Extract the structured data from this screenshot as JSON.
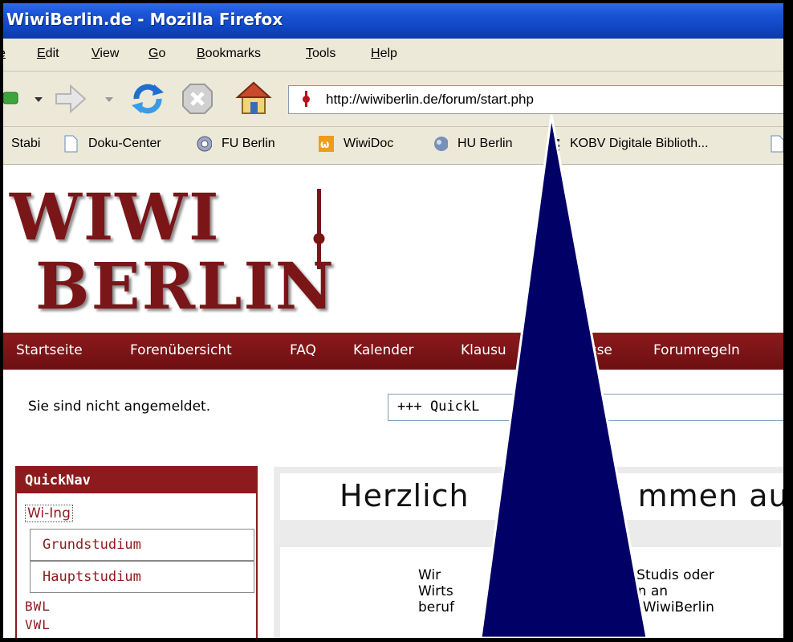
{
  "window": {
    "title": "WiwiBerlin.de - Mozilla Firefox"
  },
  "menu": [
    {
      "label": "e"
    },
    {
      "label": "Edit"
    },
    {
      "label": "View"
    },
    {
      "label": "Go"
    },
    {
      "label": "Bookmarks"
    },
    {
      "label": "Tools"
    },
    {
      "label": "Help"
    }
  ],
  "address": {
    "url": "http://wiwiberlin.de/forum/start.php"
  },
  "bookmarks": [
    {
      "label": "Stabi"
    },
    {
      "label": "Doku-Center"
    },
    {
      "label": "FU Berlin"
    },
    {
      "label": "WiwiDoc"
    },
    {
      "label": "HU Berlin"
    },
    {
      "label": "KOBV Digitale Biblioth..."
    }
  ],
  "logo": {
    "line1": "WIWI",
    "line2": "BERLIN"
  },
  "site_nav": [
    {
      "label": "Startseite"
    },
    {
      "label": "Forenübersicht"
    },
    {
      "label": "FAQ"
    },
    {
      "label": "Kalender"
    },
    {
      "label": "Klausu"
    },
    {
      "label": "isse"
    },
    {
      "label": "Forumregeln"
    }
  ],
  "login_status": "Sie sind nicht angemeldet.",
  "quicklinks": {
    "value": "+++ QuickL"
  },
  "quicknav": {
    "title": "QuickNav",
    "active": "Wi-Ing",
    "sub": [
      {
        "label": "Grundstudium"
      },
      {
        "label": "Hauptstudium"
      }
    ],
    "links": [
      {
        "label": "BWL"
      },
      {
        "label": "VWL"
      }
    ]
  },
  "welcome": {
    "heading_left": "Herzlich",
    "heading_right": "mmen au",
    "lines": [
      {
        "a": "Wir",
        "b": "Studis   oder"
      },
      {
        "a": "Wirts",
        "b": "haften    an"
      },
      {
        "a": "beruf",
        "b": "n auf WiwiBerlin"
      }
    ]
  },
  "colors": {
    "brand": "#8d1a1c",
    "arrow": "#000066",
    "titlebar": "#0f45c2"
  }
}
